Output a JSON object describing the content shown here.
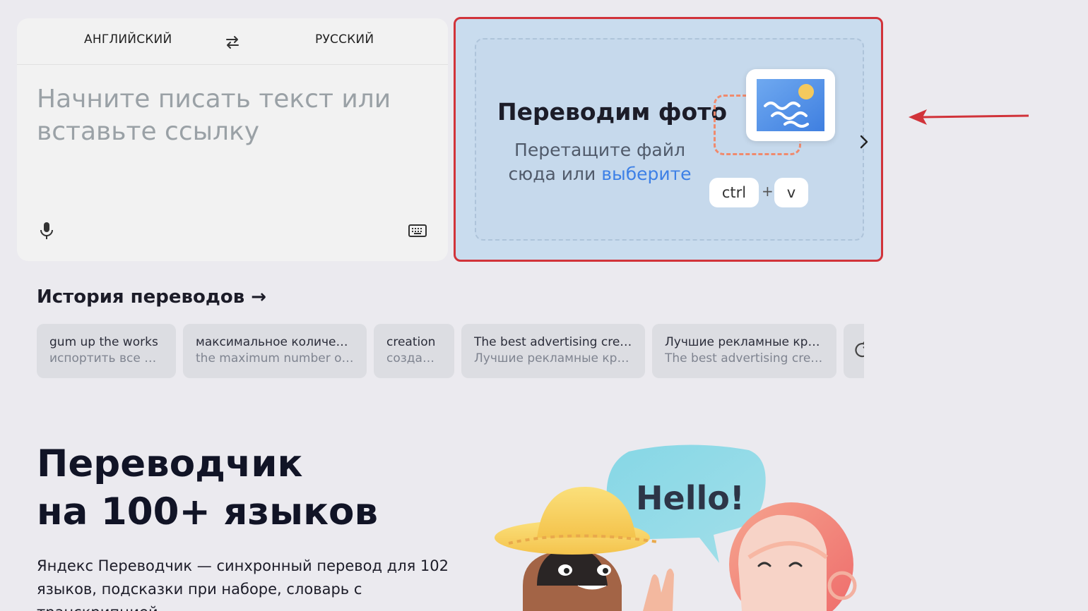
{
  "translator": {
    "source_lang": "АНГЛИЙСКИЙ",
    "target_lang": "РУССКИЙ",
    "placeholder": "Начните писать текст или вставьте ссылку",
    "swap_icon": "swap-arrows-icon",
    "mic_icon": "microphone-icon",
    "keyboard_icon": "keyboard-icon"
  },
  "photo": {
    "title": "Переводим фото",
    "subtitle_prefix": "Перетащите файл сюда или",
    "subtitle_link": "выберите",
    "key_ctrl": "ctrl",
    "key_plus": "+",
    "key_v": "v",
    "border_color": "#d1333a",
    "background_color": "#c9dcee"
  },
  "history": {
    "title": "История переводов →",
    "items": [
      {
        "source": "gum up the works",
        "translation": "испортить все дело"
      },
      {
        "source": "максимальное количест...",
        "translation": "the maximum number of c..."
      },
      {
        "source": "creation",
        "translation": "создание"
      },
      {
        "source": "The best advertising crea...",
        "translation": "Лучшие рекламные креа..."
      },
      {
        "source": "Лучшие рекламные кре...",
        "translation": "The best advertising creati..."
      }
    ]
  },
  "hero": {
    "title_line1": "Переводчик",
    "title_line2": "на 100+ языков",
    "text": "Яндекс Переводчик — синхронный перевод для 102 языков, подсказки при наборе, словарь с транскрипцией,",
    "bubble_text": "Hello!"
  },
  "colors": {
    "page_bg": "#ebeaef",
    "link": "#3d80e6",
    "annotation": "#d1333a"
  }
}
